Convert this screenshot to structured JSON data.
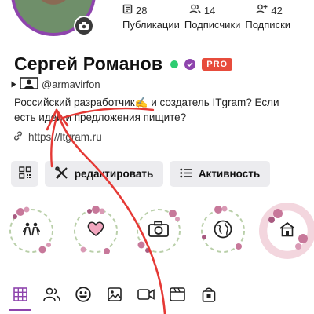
{
  "profile": {
    "name": "Сергей Романов",
    "pro_label": "PRO",
    "username": "@armavirfon",
    "bio": "Российский разработчик✍️ и создатель ITgram? Если есть идеи и предложения пищите?",
    "link": "https://ltgram.ru"
  },
  "stats": [
    {
      "value": "28",
      "label": "Публикации",
      "icon": "posts-icon"
    },
    {
      "value": "14",
      "label": "Подписчики",
      "icon": "followers-icon"
    },
    {
      "value": "42",
      "label": "Подписки",
      "icon": "following-icon"
    }
  ],
  "buttons": {
    "edit_label": "редактировать",
    "activity_label": "Активность"
  },
  "highlights": [
    {
      "icon": "friends-icon"
    },
    {
      "icon": "heart-icon"
    },
    {
      "icon": "camera-icon"
    },
    {
      "icon": "globe-icon"
    },
    {
      "icon": "home-icon"
    }
  ],
  "tabs": [
    {
      "icon": "grid-icon",
      "active": true
    },
    {
      "icon": "people-icon"
    },
    {
      "icon": "emoji-icon"
    },
    {
      "icon": "image-icon"
    },
    {
      "icon": "video-icon"
    },
    {
      "icon": "clapper-icon"
    },
    {
      "icon": "lock-bag-icon"
    }
  ],
  "colors": {
    "accent": "#8e44ad",
    "online": "#2ecc71",
    "pro": "#e74c3c",
    "annotation": "#e53935"
  }
}
